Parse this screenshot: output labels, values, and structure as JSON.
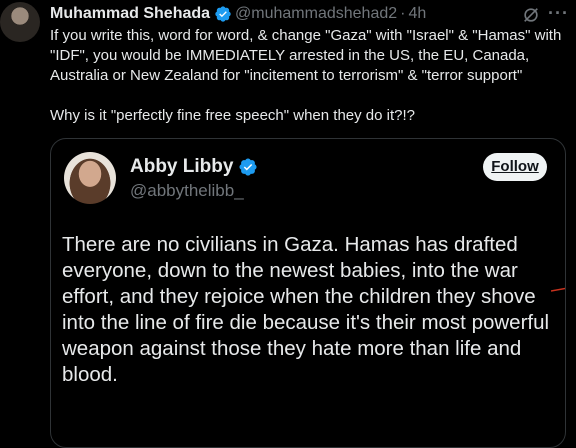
{
  "tweet": {
    "author_name": "Muhammad Shehada",
    "author_handle": "@muhammadshehad2",
    "separator": "·",
    "time": "4h",
    "more_label": "···",
    "body_line1": "If you write this, word for word, & change \"Gaza\" with \"Israel\" & \"Hamas\" with \"IDF\", you would be IMMEDIATELY arrested in the US, the EU, Canada, Australia or New Zealand for \"incitement to terrorism\" & \"terror support\"",
    "body_line2": "Why is it \"perfectly fine free speech\" when they do it?!?"
  },
  "quote": {
    "author_name": "Abby Libby",
    "author_handle": "@abbythelibb_",
    "follow_label": "Follow",
    "text": "There are no civilians in Gaza. Hamas has drafted everyone, down to the newest babies, into the war effort, and they rejoice when the children they shove into the line of fire die because it's their most powerful weapon against those they hate more than life and blood."
  },
  "colors": {
    "background": "#000000",
    "text": "#e7e9ea",
    "muted": "#71767b",
    "verified": "#1d9bf0",
    "border": "#2f3336",
    "follow_bg": "#eff3f4"
  },
  "icons": {
    "verified": "verified-badge-icon",
    "grok": "grok-icon",
    "more": "more-icon"
  }
}
